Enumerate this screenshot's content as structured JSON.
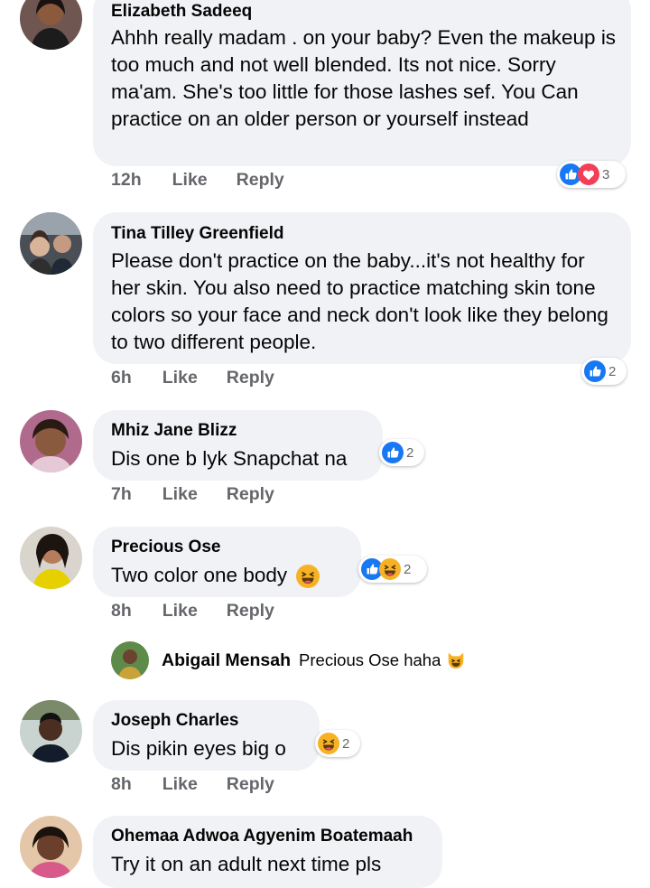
{
  "comments": [
    {
      "author": "Elizabeth Sadeeq",
      "text": "Ahhh really madam   . on your baby? Even the makeup is too much and not well blended. Its not nice. Sorry ma'am. She's too little for those lashes sef. You Can practice on an older person or yourself instead",
      "time": "12h",
      "like": "Like",
      "reply": "Reply",
      "reaction_count": "3",
      "reactions": [
        "like-icon",
        "love-icon"
      ]
    },
    {
      "author": "Tina Tilley Greenfield",
      "text": "Please don't practice on the baby...it's not healthy for her skin. You also need to practice matching skin tone colors so your face and neck don't look like they belong to two different people.",
      "time": "6h",
      "like": "Like",
      "reply": "Reply",
      "reaction_count": "2",
      "reactions": [
        "like-icon"
      ]
    },
    {
      "author": "Mhiz Jane Blizz",
      "text": "Dis one b lyk Snapchat na",
      "time": "7h",
      "like": "Like",
      "reply": "Reply",
      "reaction_count": "2",
      "reactions": [
        "like-icon"
      ]
    },
    {
      "author": "Precious Ose",
      "text": "Two color one body",
      "time": "8h",
      "like": "Like",
      "reply": "Reply",
      "reaction_count": "2",
      "reactions": [
        "like-icon",
        "haha-icon"
      ],
      "reply_item": {
        "author": "Abigail Mensah",
        "text": "Precious Ose haha"
      }
    },
    {
      "author": "Joseph Charles",
      "text": "Dis pikin eyes big o",
      "time": "8h",
      "like": "Like",
      "reply": "Reply",
      "reaction_count": "2",
      "reactions": [
        "haha-icon"
      ]
    },
    {
      "author": "Ohemaa Adwoa Agyenim Boatemaah",
      "text": "Try it on an adult next time pls"
    }
  ],
  "colors": {
    "bubble": "#f0f2f5",
    "meta_gray": "#65676b",
    "like_blue": "#1877f2",
    "love_red": "#f33e58",
    "haha_yellow": "#f7b125"
  }
}
